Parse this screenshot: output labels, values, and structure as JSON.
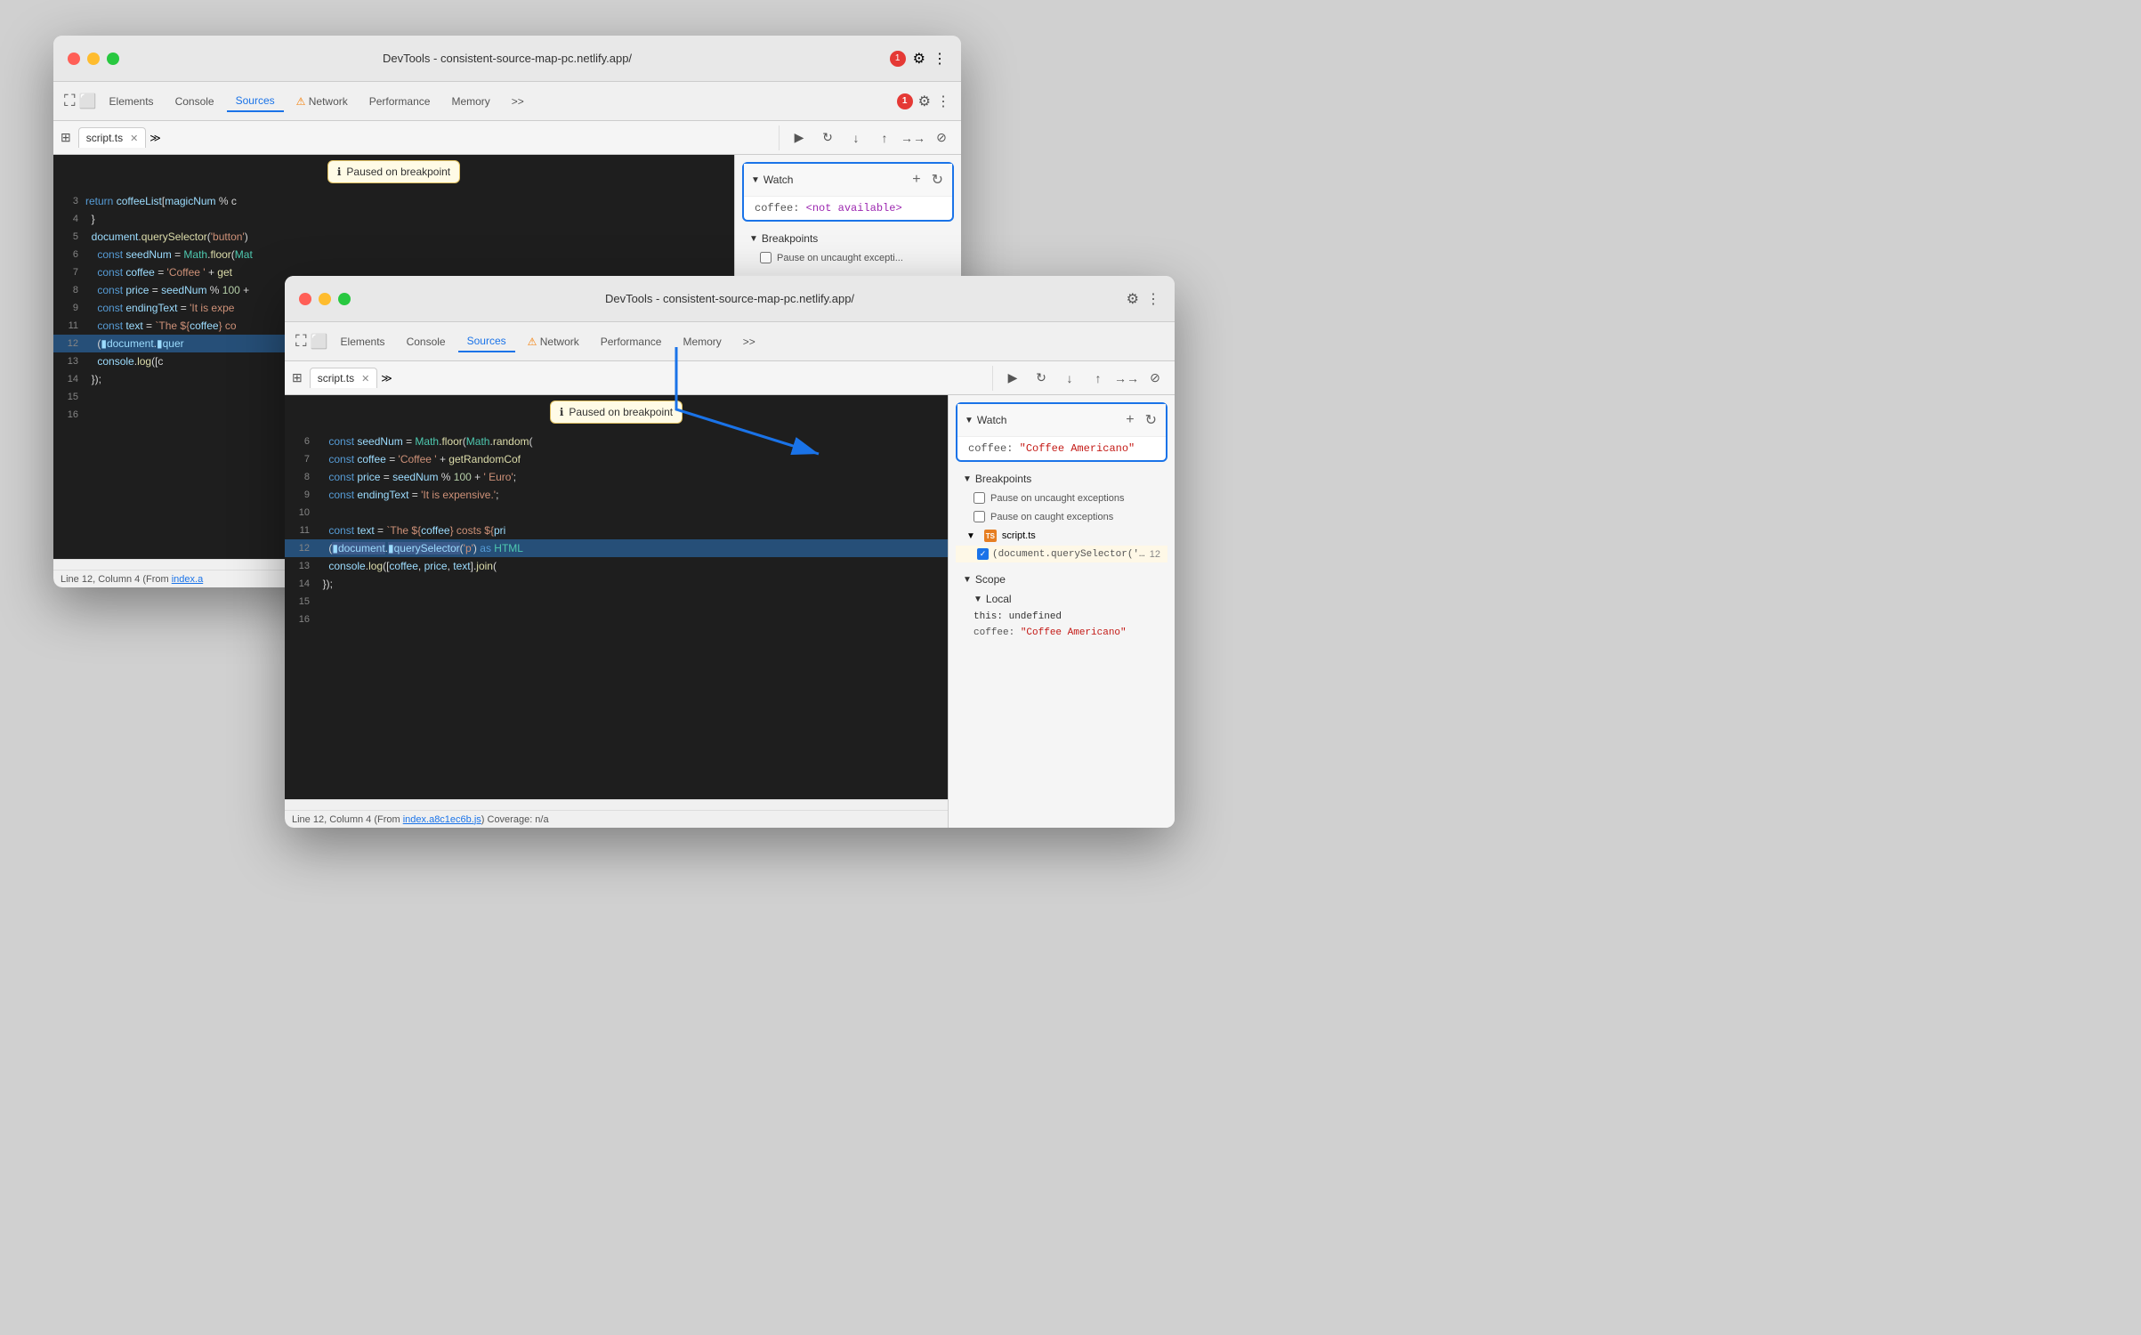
{
  "window1": {
    "title": "DevTools - consistent-source-map-pc.netlify.app/",
    "tabs": [
      {
        "label": "Elements",
        "active": false
      },
      {
        "label": "Console",
        "active": false
      },
      {
        "label": "Sources",
        "active": true
      },
      {
        "label": "Network",
        "active": false,
        "warning": true
      },
      {
        "label": "Performance",
        "active": false
      },
      {
        "label": "Memory",
        "active": false
      }
    ],
    "error_count": "1",
    "file_tab": "script.ts",
    "code_lines": [
      {
        "num": "3",
        "content": "    return coffeeList[magicNum % c"
      },
      {
        "num": "4",
        "content": "  }"
      },
      {
        "num": "5",
        "content": "  document.querySelector('button')"
      },
      {
        "num": "6",
        "content": "    const seedNum = Math.floor(Mat"
      },
      {
        "num": "7",
        "content": "    const coffee = 'Coffee ' + get"
      },
      {
        "num": "8",
        "content": "    const price = seedNum % 100 +"
      },
      {
        "num": "9",
        "content": "    const endingText = 'It is expe"
      },
      {
        "num": "11",
        "content": "    const text = `The ${coffee} co"
      },
      {
        "num": "12",
        "content": "    (document.querySelector",
        "highlighted": true
      },
      {
        "num": "13",
        "content": "    console.log([c"
      },
      {
        "num": "14",
        "content": "  });"
      },
      {
        "num": "15",
        "content": ""
      },
      {
        "num": "16",
        "content": ""
      }
    ],
    "status_bar": {
      "left": "Line 12, Column 4 (From ",
      "link": "index.a",
      "link_after": ""
    },
    "debug_buttons": [
      "resume",
      "step-over",
      "step-into",
      "step-out",
      "deactivate"
    ],
    "paused_tooltip": "Paused on breakpoint",
    "watch": {
      "title": "Watch",
      "item": "coffee: <not available>",
      "item_key": "coffee:",
      "item_value": " <not available>"
    },
    "breakpoints": {
      "title": "Breakpoints",
      "items": [
        "Pause on uncaught exceptions"
      ]
    }
  },
  "window2": {
    "title": "DevTools - consistent-source-map-pc.netlify.app/",
    "tabs": [
      {
        "label": "Elements",
        "active": false
      },
      {
        "label": "Console",
        "active": false
      },
      {
        "label": "Sources",
        "active": true
      },
      {
        "label": "Network",
        "active": false,
        "warning": true
      },
      {
        "label": "Performance",
        "active": false
      },
      {
        "label": "Memory",
        "active": false
      }
    ],
    "file_tab": "script.ts",
    "code_lines": [
      {
        "num": "6",
        "content": "    const seedNum = Math.floor(Math.random("
      },
      {
        "num": "7",
        "content": "    const coffee = 'Coffee ' + getRandomCof"
      },
      {
        "num": "8",
        "content": "    const price = seedNum % 100 + ' Euro';"
      },
      {
        "num": "9",
        "content": "    const endingText = 'It is expensive.';"
      },
      {
        "num": "10",
        "content": ""
      },
      {
        "num": "11",
        "content": "    const text = `The ${coffee} costs ${pri"
      },
      {
        "num": "12",
        "content": "    (document.querySelector('p') as HTML",
        "highlighted": true
      },
      {
        "num": "13",
        "content": "    console.log([coffee, price, text].join("
      },
      {
        "num": "14",
        "content": "  });"
      },
      {
        "num": "15",
        "content": ""
      },
      {
        "num": "16",
        "content": ""
      }
    ],
    "status_bar": {
      "text": "Line 12, Column 4  (From ",
      "link": "index.a8c1ec6b.js",
      "after": ") Coverage: n/a"
    },
    "debug_buttons": [
      "resume",
      "step-over",
      "step-into",
      "step-out",
      "deactivate"
    ],
    "paused_tooltip": "Paused on breakpoint",
    "watch": {
      "title": "Watch",
      "item_key": "coffee:",
      "item_value": " \"Coffee Americano\""
    },
    "breakpoints": {
      "title": "Breakpoints",
      "pause_uncaught": "Pause on uncaught exceptions",
      "pause_caught": "Pause on caught exceptions",
      "file": "script.ts",
      "bp_line": "(document.querySelector('p') as HTMLP…",
      "bp_line_num": "12"
    },
    "scope": {
      "title": "Scope",
      "local": {
        "title": "Local",
        "this": "this: undefined",
        "coffee": "coffee: \"Coffee Americano\""
      }
    }
  },
  "arrow": {
    "label": "arrow connecting watch panels"
  }
}
